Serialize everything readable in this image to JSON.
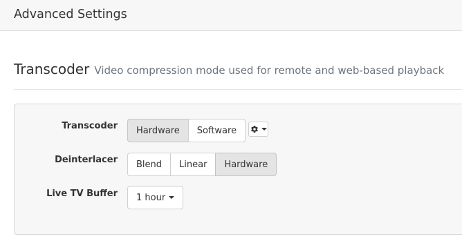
{
  "header": {
    "title": "Advanced Settings"
  },
  "section": {
    "title": "Transcoder",
    "subtitle": "Video compression mode used for remote and web-based playback"
  },
  "settings": {
    "transcoder": {
      "label": "Transcoder",
      "options": [
        "Hardware",
        "Software"
      ],
      "selected": "Hardware",
      "settings_icon": "gear-icon"
    },
    "deinterlacer": {
      "label": "Deinterlacer",
      "options": [
        "Blend",
        "Linear",
        "Hardware"
      ],
      "selected": "Hardware"
    },
    "live_tv_buffer": {
      "label": "Live TV Buffer",
      "value": "1 hour"
    }
  },
  "colors": {
    "active_button": "#e4e4e4",
    "card_background": "#f7f7f7",
    "subtitle_text": "#6c757d"
  }
}
